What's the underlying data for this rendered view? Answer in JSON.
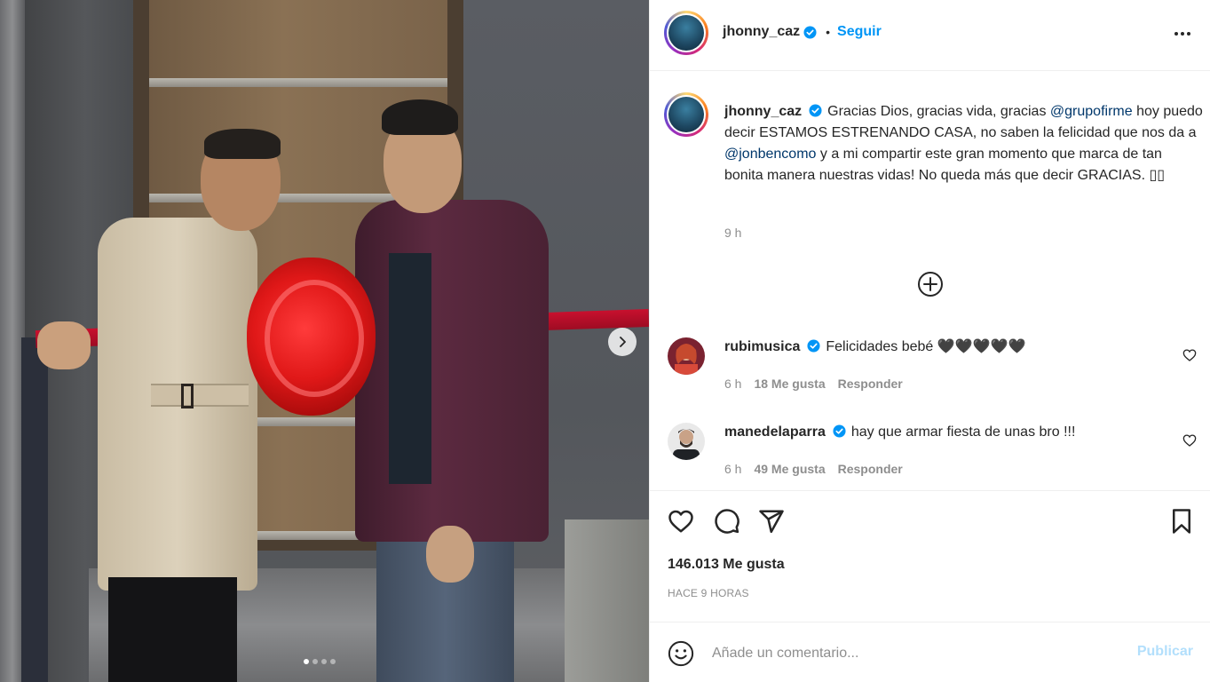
{
  "post": {
    "carousel": {
      "total": 4,
      "active_index": 0
    }
  },
  "header": {
    "username": "jhonny_caz",
    "separator": "•",
    "follow_label": "Seguir"
  },
  "caption": {
    "username": "jhonny_caz",
    "text_1": "Gracias Dios, gracias vida, gracias ",
    "mention_1": "@grupofirme",
    "text_2": " hoy puedo decir ESTAMOS ESTRENANDO CASA, no saben la felicidad que nos da a ",
    "mention_2": "@jonbencomo",
    "text_3": " y a mi compartir este gran momento que marca de tan bonita manera nuestras vidas! No queda más que decir GRACIAS. ▯▯",
    "time": "9 h"
  },
  "comments": [
    {
      "username": "rubimusica",
      "text": "Felicidades bebé 🖤🖤🖤🖤🖤",
      "time": "6 h",
      "likes": "18 Me gusta",
      "reply": "Responder"
    },
    {
      "username": "manedelaparra",
      "text": "hay que armar fiesta de unas bro !!!",
      "time": "6 h",
      "likes": "49 Me gusta",
      "reply": "Responder"
    }
  ],
  "stats": {
    "likes": "146.013 Me gusta",
    "time_ago": "HACE 9 HORAS"
  },
  "comment_box": {
    "placeholder": "Añade un comentario...",
    "publish_label": "Publicar"
  },
  "colors": {
    "link": "#0095f6",
    "mention": "#00376b",
    "muted": "#8e8e8e",
    "publish_disabled": "#b2dffc"
  }
}
